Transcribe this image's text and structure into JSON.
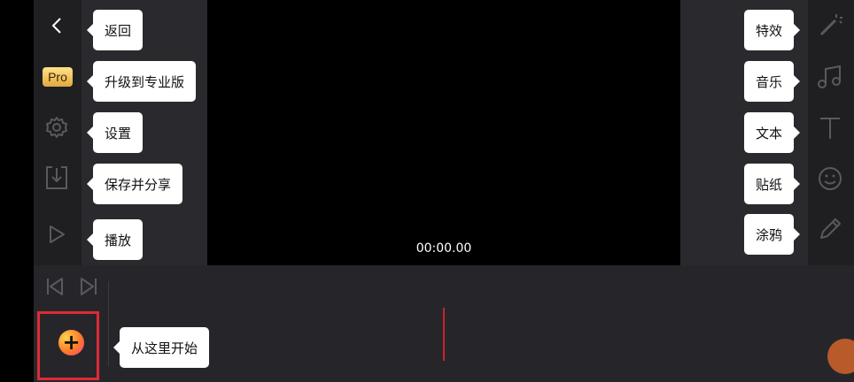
{
  "preview": {
    "timecode": "00:00.00"
  },
  "toolbar_left": {
    "pro_badge": "Pro",
    "tips": {
      "back": "返回",
      "upgrade": "升级到专业版",
      "settings": "设置",
      "save_share": "保存并分享",
      "play": "播放"
    }
  },
  "toolbar_right": {
    "tips": {
      "effects": "特效",
      "music": "音乐",
      "text": "文本",
      "stickers": "贴纸",
      "doodle": "涂鸦"
    }
  },
  "timeline": {
    "add_symbol": "+",
    "start_tip": "从这里开始"
  },
  "colors": {
    "highlight_border": "#e02a35",
    "playhead": "#d0202a",
    "pro_badge": "#e2a93c"
  }
}
